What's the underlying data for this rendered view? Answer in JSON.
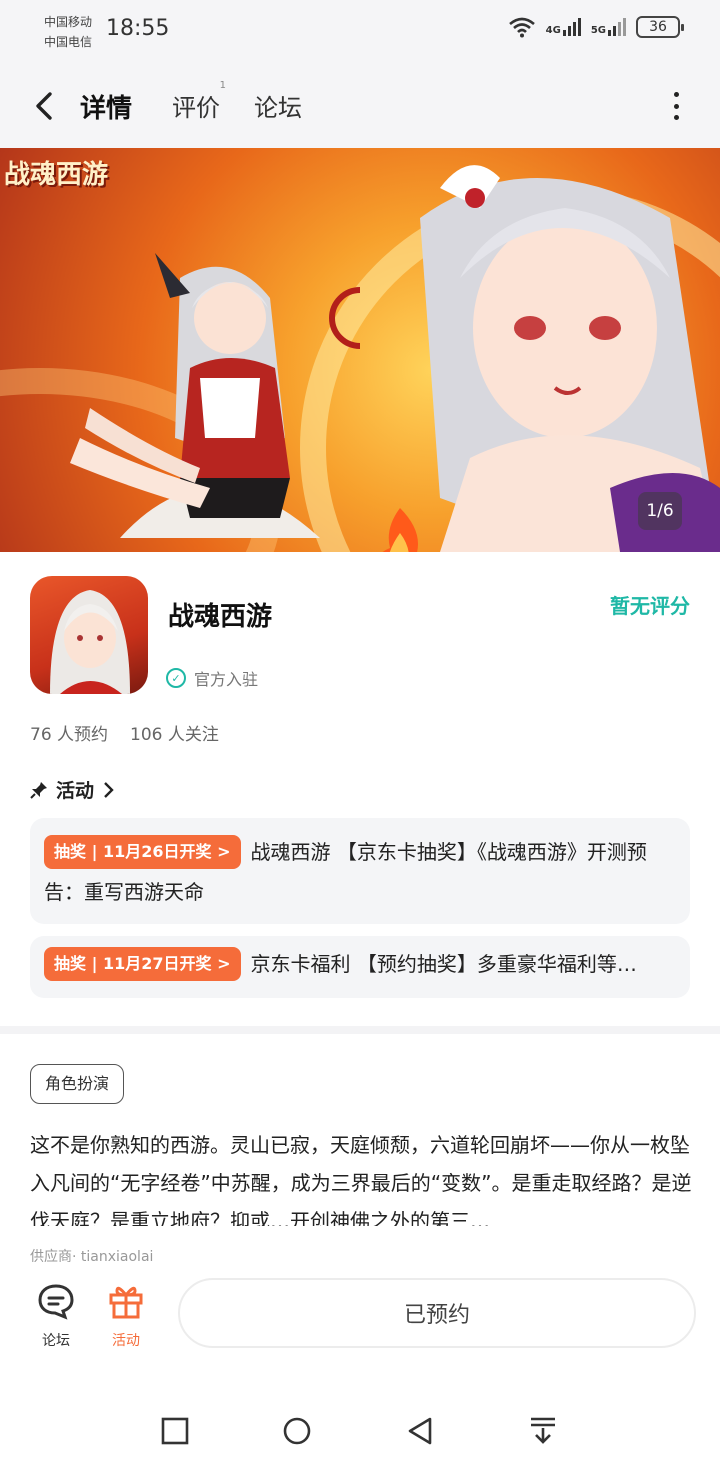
{
  "status_bar": {
    "carrier_1": "中国移动",
    "carrier_2": "中国电信",
    "time": "18:55",
    "network_1": "4G",
    "network_2": "5G",
    "battery": "36"
  },
  "nav": {
    "tabs": [
      "详情",
      "评价",
      "论坛"
    ],
    "review_badge": "1",
    "active_tab": "详情",
    "accent_color": "#21c7b5"
  },
  "banner": {
    "logo_text": "战魂西游",
    "page_indicator": "1/6"
  },
  "app": {
    "name": "战魂西游",
    "rating_text": "暂无评分",
    "official_text": "官方入驻",
    "reservations": "76 人预约",
    "followers": "106 人关注"
  },
  "activities": {
    "header": "活动",
    "items": [
      {
        "tag": "抽奖 | 11月26日开奖 >",
        "text": "战魂西游 【京东卡抽奖】《战魂西游》开测预告：重写西游天命"
      },
      {
        "tag": "抽奖 | 11月27日开奖 >",
        "text": "京东卡福利 【预约抽奖】多重豪华福利等…"
      }
    ],
    "tag_color": "#f56c3a"
  },
  "description": {
    "genre_tag": "角色扮演",
    "text": "这不是你熟知的西游。灵山已寂，天庭倾颓，六道轮回崩坏——你从一枚坠入凡间的“无字经卷”中苏醒，成为三界最后的“变数”。是重走取经路？是逆伐天庭？是重立地府？抑或…开创神佛之外的第三…",
    "developer": "供应商· tianxiaolai"
  },
  "bottom_bar": {
    "forum_label": "论坛",
    "activity_label": "活动",
    "reserve_label": "已预约"
  },
  "system_nav": {
    "icons": [
      "square-icon",
      "circle-icon",
      "back-triangle-icon",
      "download-icon"
    ]
  }
}
